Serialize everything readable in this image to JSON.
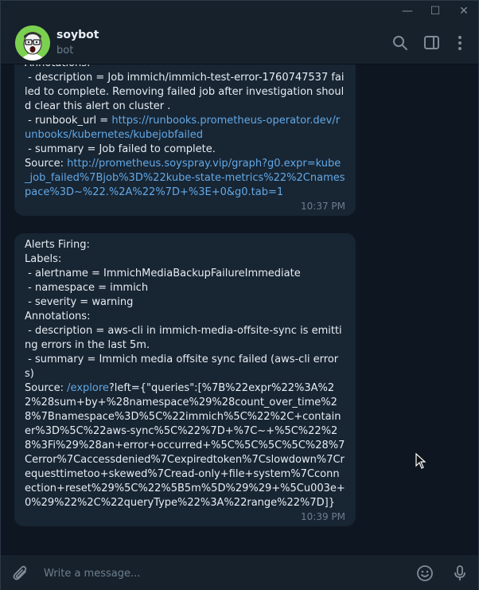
{
  "window": {
    "minimize_glyph": "—",
    "maximize_glyph": "☐",
    "close_glyph": "✕"
  },
  "header": {
    "title": "soybot",
    "subtitle": "bot",
    "icons": [
      "search-icon",
      "sidebar-toggle-icon",
      "more-vert-icon"
    ]
  },
  "messages": [
    {
      "lines": [
        {
          "text": "Annotations:"
        },
        {
          "text": " - description = Job immich/immich-test-error-1760747537 failed to complete. Removing failed job after investigation should clear this alert on cluster ."
        },
        {
          "prefix": " - runbook_url = ",
          "link": "https://runbooks.prometheus-operator.dev/runbooks/kubernetes/kubejobfailed"
        },
        {
          "text": " - summary = Job failed to complete."
        },
        {
          "prefix": "Source: ",
          "link": "http://prometheus.soyspray.vip/graph?g0.expr=kube_job_failed%7Bjob%3D%22kube-state-metrics%22%2Cnamespace%3D~%22.%2A%22%7D+%3E+0&g0.tab=1"
        }
      ],
      "time": "10:37 PM"
    },
    {
      "lines": [
        {
          "text": "Alerts Firing:"
        },
        {
          "text": "Labels:"
        },
        {
          "text": " - alertname = ImmichMediaBackupFailureImmediate"
        },
        {
          "text": " - namespace = immich"
        },
        {
          "text": " - severity = warning"
        },
        {
          "text": "Annotations:"
        },
        {
          "text": " - description = aws-cli in immich-media-offsite-sync is emitting errors in the last 5m."
        },
        {
          "text": " - summary = Immich media offsite sync failed (aws-cli errors)"
        },
        {
          "prefix": "Source: ",
          "link": "/explore",
          "suffix": "?left={\"queries\":[%7B%22expr%22%3A%22%28sum+by+%28namespace%29%28count_over_time%28%7Bnamespace%3D%5C%22immich%5C%22%2C+container%3D%5C%22aws-sync%5C%22%7D+%7C~+%5C%22%28%3Fi%29%28an+error+occurred+%5C%5C%5C%5C%28%7Cerror%7Caccessdenied%7Cexpiredtoken%7Cslowdown%7Crequesttimetoo+skewed%7Cread-only+file+system%7Cconnection+reset%29%5C%22%5B5m%5D%29%29+%5Cu003e+0%29%22%2C%22queryType%22%3A%22range%22%7D]}"
        }
      ],
      "time": "10:39 PM"
    }
  ],
  "composer": {
    "placeholder": "Write a message...",
    "icons": [
      "attach-icon",
      "emoji-icon",
      "microphone-icon"
    ]
  },
  "colors": {
    "background": "#0e1621",
    "panel": "#17212b",
    "bubble": "#182533",
    "link": "#62a9e6",
    "muted": "#6d7f8f"
  }
}
